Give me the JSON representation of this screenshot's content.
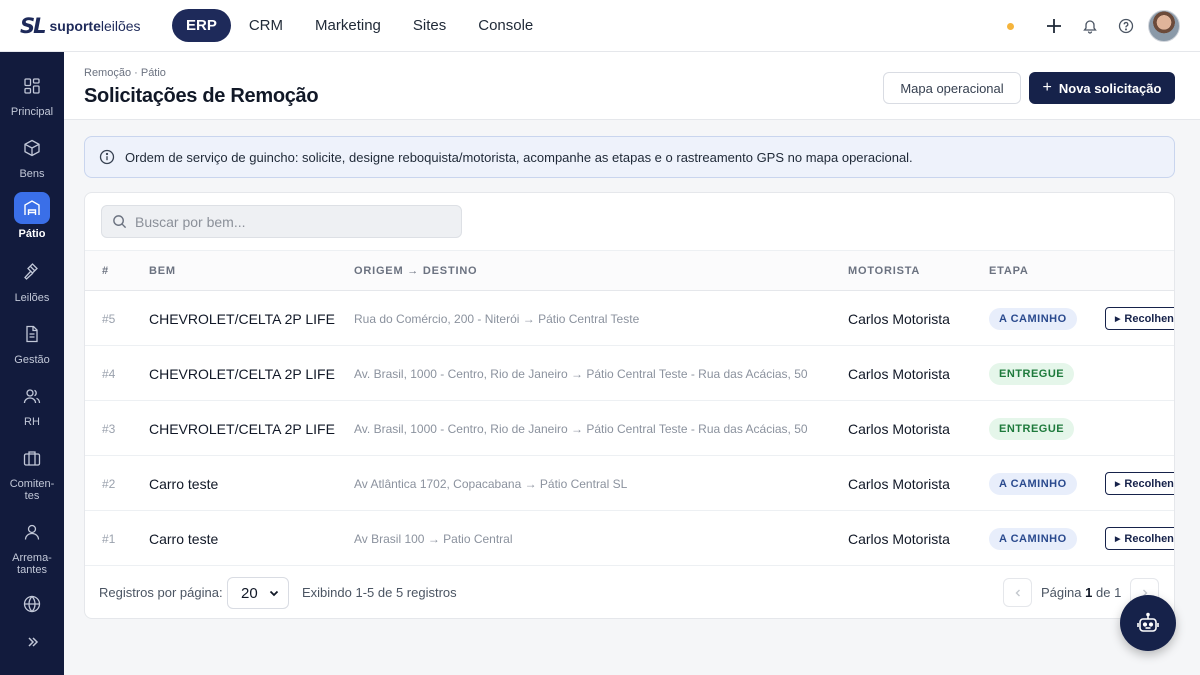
{
  "brand": {
    "mark": "SL",
    "name_bold": "suporte",
    "name_light": "leilões"
  },
  "topnav": [
    {
      "label": "ERP",
      "active": true
    },
    {
      "label": "CRM",
      "active": false
    },
    {
      "label": "Marketing",
      "active": false
    },
    {
      "label": "Sites",
      "active": false
    },
    {
      "label": "Console",
      "active": false
    }
  ],
  "sidebar": [
    {
      "label": "Principal",
      "icon": "grid-icon"
    },
    {
      "label": "Bens",
      "icon": "box-icon"
    },
    {
      "label": "Pátio",
      "icon": "building-icon",
      "active": true
    },
    {
      "label": "Leilões",
      "icon": "gavel-icon"
    },
    {
      "label": "Gestão",
      "icon": "document-icon"
    },
    {
      "label": "RH",
      "icon": "users-icon"
    },
    {
      "label": "Comiten-tes",
      "icon": "briefcase-icon"
    },
    {
      "label": "Arrema-tantes",
      "icon": "user-icon"
    },
    {
      "label": "",
      "icon": "globe-icon"
    }
  ],
  "header": {
    "breadcrumb": "Remoção · Pátio",
    "title": "Solicitações de Remoção",
    "secondary_button": "Mapa operacional",
    "primary_button": "Nova solicitação"
  },
  "info": "Ordem de serviço de guincho: solicite, designe reboquista/motorista, acompanhe as etapas e o rastreamento GPS no mapa operacional.",
  "search": {
    "placeholder": "Buscar por bem..."
  },
  "table": {
    "columns": [
      "#",
      "BEM",
      "ORIGEM → DESTINO",
      "MOTORISTA",
      "ETAPA"
    ],
    "rows": [
      {
        "id": "#5",
        "bem": "CHEVROLET/CELTA 2P LIFE",
        "route": "Rua do Comércio, 200 - Niterói → Pátio Central Teste",
        "motorista": "Carlos Motorista",
        "etapa": "A CAMINHO",
        "etapa_type": "caminho",
        "action": "Recolhendo"
      },
      {
        "id": "#4",
        "bem": "CHEVROLET/CELTA 2P LIFE",
        "route": "Av. Brasil, 1000 - Centro, Rio de Janeiro → Pátio Central Teste - Rua das Acácias, 50",
        "motorista": "Carlos Motorista",
        "etapa": "ENTREGUE",
        "etapa_type": "entregue",
        "action": ""
      },
      {
        "id": "#3",
        "bem": "CHEVROLET/CELTA 2P LIFE",
        "route": "Av. Brasil, 1000 - Centro, Rio de Janeiro → Pátio Central Teste - Rua das Acácias, 50",
        "motorista": "Carlos Motorista",
        "etapa": "ENTREGUE",
        "etapa_type": "entregue",
        "action": ""
      },
      {
        "id": "#2",
        "bem": "Carro teste",
        "route": "Av Atlântica 1702, Copacabana → Pátio Central SL",
        "motorista": "Carlos Motorista",
        "etapa": "A CAMINHO",
        "etapa_type": "caminho",
        "action": "Recolhendo"
      },
      {
        "id": "#1",
        "bem": "Carro teste",
        "route": "Av Brasil 100 → Patio Central",
        "motorista": "Carlos Motorista",
        "etapa": "A CAMINHO",
        "etapa_type": "caminho",
        "action": "Recolhendo"
      }
    ]
  },
  "footer": {
    "per_page_label": "Registros por página:",
    "per_page_value": "20",
    "showing": "Exibindo 1-5 de 5 registros",
    "page_prefix": "Página",
    "page_current": "1",
    "page_sep": "de",
    "page_total": "1"
  },
  "colors": {
    "navy": "#16224a",
    "sidebar": "#121b3d",
    "accent": "#3a6fe8",
    "badge_blue": "#2a4a8e",
    "badge_green": "#1e7a3c"
  }
}
